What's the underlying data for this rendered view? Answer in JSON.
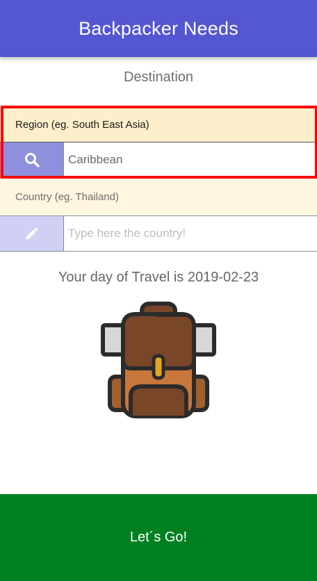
{
  "appbar": {
    "title": "Backpacker Needs"
  },
  "destination": {
    "title": "Destination",
    "region": {
      "label": "Region (eg. South East Asia)",
      "value": "Caribbean",
      "icon": "search-icon"
    },
    "country": {
      "label": "Country (eg. Thailand)",
      "placeholder": "Type here the country!",
      "value": "",
      "icon": "pencil-icon"
    }
  },
  "travel": {
    "day_text": "Your day of Travel is 2019-02-23"
  },
  "illustration": {
    "icon": "backpack-icon"
  },
  "actions": {
    "go_label": "Let´s Go!"
  },
  "colors": {
    "appbar": "#5456d2",
    "region_label_bg": "#fdefcb",
    "country_label_bg": "#fff6df",
    "search_icon_bg": "#8f90dd",
    "pencil_icon_bg": "#cfd0f4",
    "go_button": "#008020",
    "highlight": "#ff0000"
  }
}
